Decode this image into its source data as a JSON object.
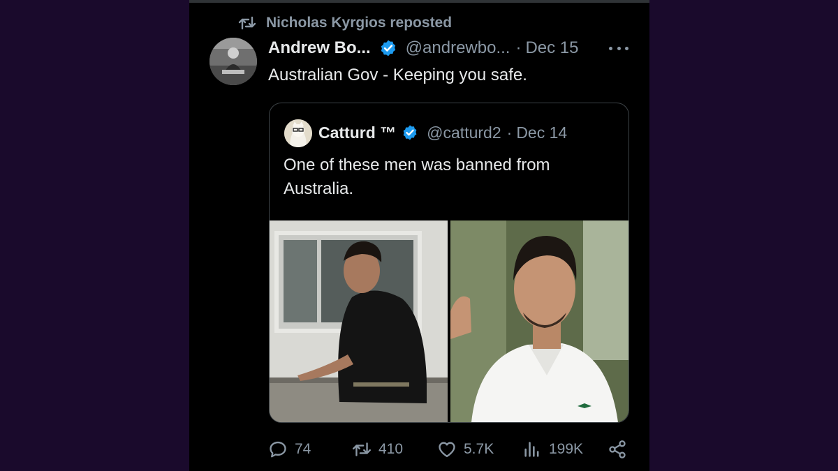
{
  "colors": {
    "accent": "#1d9bf0",
    "muted": "#8b98a5",
    "text": "#e7e9ea",
    "backdrop": "#1a0a2c",
    "card": "#000000"
  },
  "repost": {
    "icon": "repost-icon",
    "label": "Nicholas Kyrgios reposted"
  },
  "tweet": {
    "author_name": "Andrew Bo...",
    "verified_icon": "verified-badge-icon",
    "handle": "@andrewbo...",
    "separator": "·",
    "date": "Dec 15",
    "more_icon": "more-options-icon",
    "text": "Australian Gov - Keeping you safe."
  },
  "quote": {
    "author_name": "Catturd ™",
    "verified_icon": "verified-badge-icon",
    "handle": "@catturd2",
    "separator": "·",
    "date": "Dec 14",
    "text": "One of these men was banned from Australia.",
    "media": [
      "photo-man-on-rooftop",
      "photo-tennis-player"
    ]
  },
  "actions": {
    "reply": {
      "icon": "reply-icon",
      "count": "74"
    },
    "repost": {
      "icon": "repost-icon",
      "count": "410"
    },
    "like": {
      "icon": "like-heart-icon",
      "count": "5.7K"
    },
    "views": {
      "icon": "views-chart-icon",
      "count": "199K"
    },
    "share": {
      "icon": "share-icon"
    }
  }
}
